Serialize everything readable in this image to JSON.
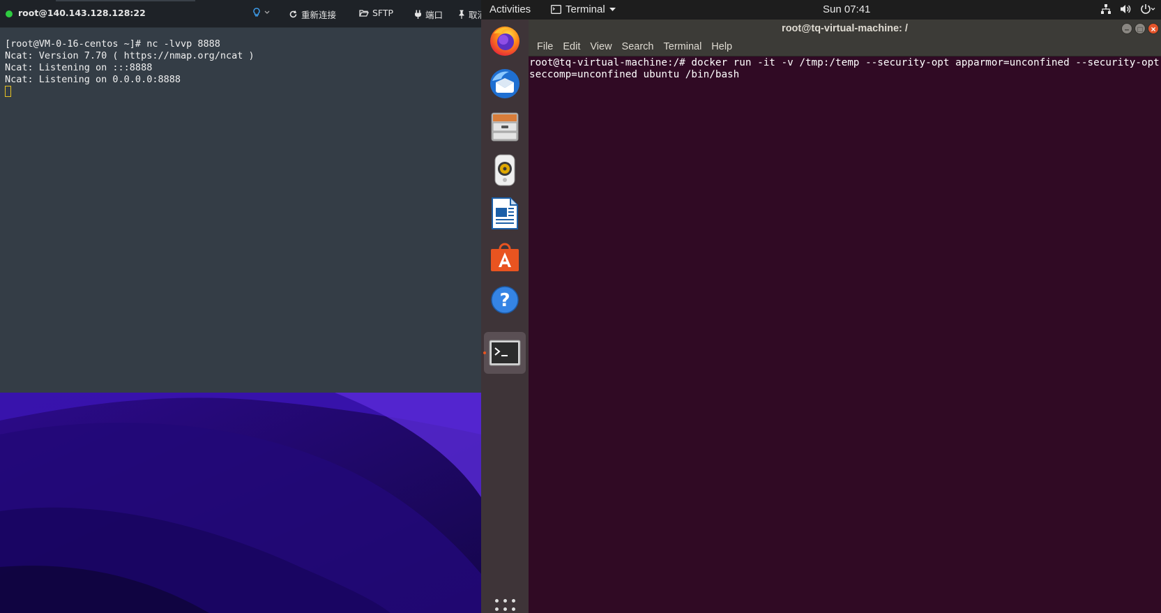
{
  "ssh_client": {
    "host": "root@140.143.128.128:22",
    "toolbar": {
      "reconnect_label": "重新连接",
      "sftp_label": "SFTP",
      "port_label": "端口",
      "pin_label": "取消"
    },
    "terminal_lines": [
      "[root@VM-0-16-centos ~]# nc -lvvp 8888",
      "Ncat: Version 7.70 ( https://nmap.org/ncat )",
      "Ncat: Listening on :::8888",
      "Ncat: Listening on 0.0.0.0:8888"
    ],
    "colors": {
      "background": "#343d46",
      "status": "#2ecc40",
      "cursor": "#e8c322"
    }
  },
  "topbar": {
    "activities": "Activities",
    "app_name": "Terminal",
    "clock": "Sun 07:41",
    "tray_icons": [
      "network-icon",
      "volume-icon",
      "power-icon"
    ]
  },
  "dock": {
    "apps": [
      "firefox-icon",
      "thunderbird-icon",
      "files-icon",
      "rhythmbox-icon",
      "libreoffice-writer-icon",
      "software-center-icon",
      "help-icon",
      "terminal-icon"
    ],
    "active_app": "terminal-icon",
    "accent": "#e95420"
  },
  "terminal_window": {
    "title": "root@tq-virtual-machine: /",
    "menu": [
      "File",
      "Edit",
      "View",
      "Search",
      "Terminal",
      "Help"
    ],
    "content": "root@tq-virtual-machine:/# docker run -it -v /tmp:/temp --security-opt apparmor=unconfined --security-opt seccomp=unconfined ubuntu /bin/bash",
    "colors": {
      "background": "#300a24",
      "titlebar": "#3c3b37",
      "close": "#e5542a"
    }
  }
}
